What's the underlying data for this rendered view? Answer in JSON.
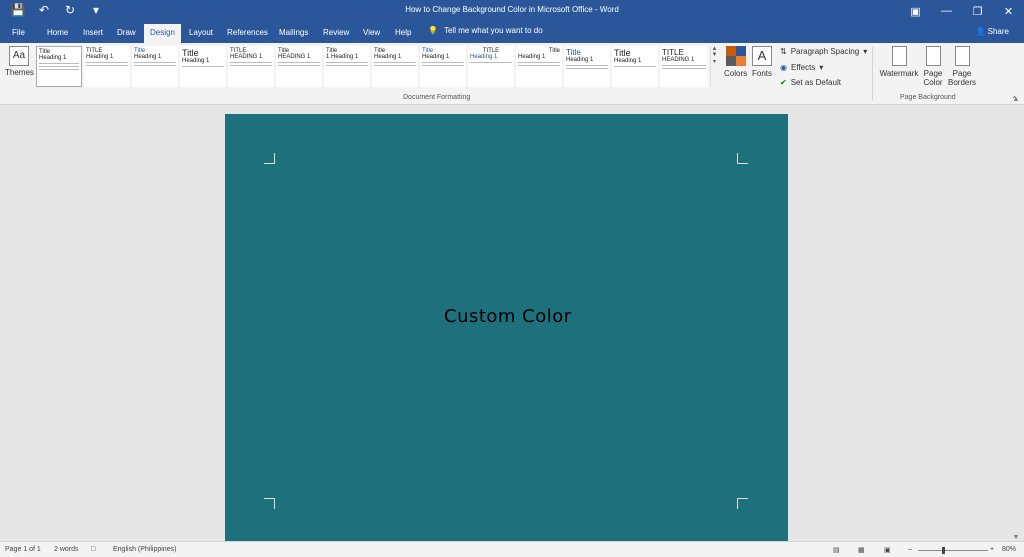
{
  "window": {
    "title": "How to Change Background Color in Microsoft Office  -  Word",
    "share_label": "Share"
  },
  "tabs": [
    "File",
    "Home",
    "Insert",
    "Draw",
    "Design",
    "Layout",
    "References",
    "Mailings",
    "Review",
    "View",
    "Help"
  ],
  "active_tab": "Design",
  "tell_me": "Tell me what you want to do",
  "ribbon": {
    "themes_label": "Themes",
    "styles": [
      {
        "title": "Title",
        "heading": "Heading 1"
      },
      {
        "title": "TITLE",
        "heading": "Heading 1"
      },
      {
        "title": "Title",
        "heading": "Heading 1"
      },
      {
        "title": "Title",
        "heading": "Heading 1"
      },
      {
        "title": "TITLE",
        "heading": "HEADING 1"
      },
      {
        "title": "Title",
        "heading": "HEADING 1"
      },
      {
        "title": "Title",
        "heading": "1 Heading 1"
      },
      {
        "title": "Title",
        "heading": "Heading 1"
      },
      {
        "title": "Title",
        "heading": "Heading 1"
      },
      {
        "title": "TITLE",
        "heading": "Heading 1"
      },
      {
        "title": "Title",
        "heading": "Heading 1"
      },
      {
        "title": "Title",
        "heading": "Heading 1"
      },
      {
        "title": "Title",
        "heading": "Heading 1"
      },
      {
        "title": "TITLE",
        "heading": "HEADING 1"
      }
    ],
    "colors_label": "Colors",
    "fonts_label": "Fonts",
    "paragraph_spacing": "Paragraph Spacing",
    "effects": "Effects",
    "set_default": "Set as Default",
    "document_formatting": "Document Formatting",
    "watermark": "Watermark",
    "page_color_1": "Page",
    "page_color_2": "Color",
    "page_borders_1": "Page",
    "page_borders_2": "Borders",
    "page_background": "Page Background"
  },
  "document": {
    "text": "Custom Color",
    "page_color": "#1e707c"
  },
  "status": {
    "page": "Page 1 of 1",
    "words": "2 words",
    "language": "English (Philippines)",
    "zoom": "80%"
  }
}
